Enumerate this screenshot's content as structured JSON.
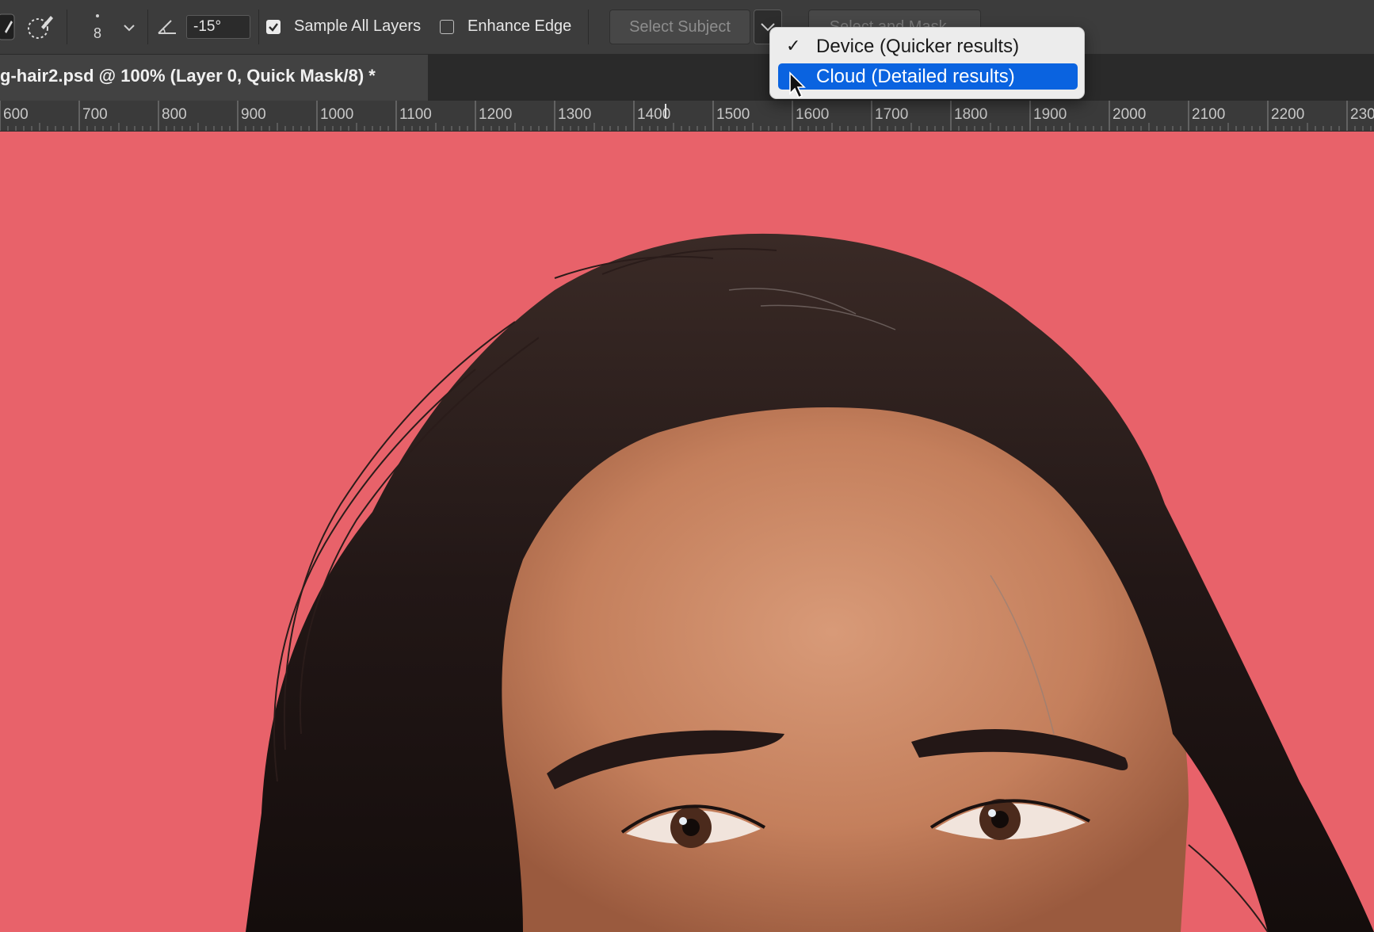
{
  "options_bar": {
    "brush_size": "8",
    "angle_value": "-15°",
    "sample_all_layers": {
      "label": "Sample All Layers",
      "checked": true
    },
    "enhance_edge": {
      "label": "Enhance Edge",
      "checked": false
    },
    "select_subject_label": "Select Subject",
    "select_and_mask_label": "Select and Mask..."
  },
  "document_tab": {
    "title": "g-hair2.psd @ 100% (Layer 0, Quick Mask/8) *"
  },
  "ruler": {
    "labels": [
      "600",
      "700",
      "800",
      "900",
      "1000",
      "1100",
      "1200",
      "1300",
      "1400",
      "1500",
      "1600",
      "1700",
      "1800",
      "1900",
      "2000",
      "2100",
      "2200",
      "230"
    ]
  },
  "dropdown": {
    "items": [
      {
        "label": "Device (Quicker results)",
        "checked": true,
        "highlighted": false
      },
      {
        "label": "Cloud (Detailed results)",
        "checked": false,
        "highlighted": true
      }
    ]
  },
  "icons": {
    "brush": "brush-tool-icon",
    "quick_select": "quick-selection-brush-icon",
    "angle": "angle-icon",
    "chevron": "chevron-down-icon",
    "checkmark": "checkmark-icon",
    "cursor": "mouse-pointer-icon"
  },
  "colors": {
    "background_red": "#e8626a",
    "menu_highlight": "#0a63e0",
    "ui_dark": "#3c3c3c"
  }
}
